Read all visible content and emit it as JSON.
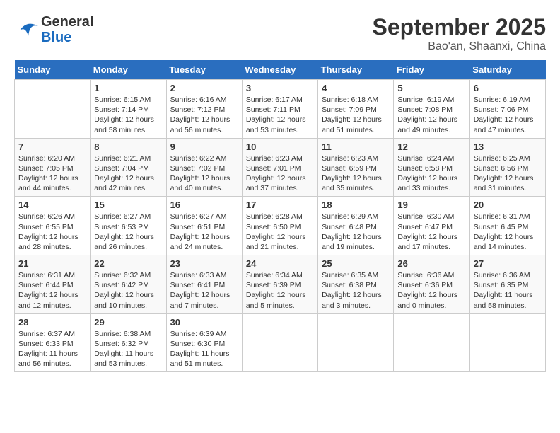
{
  "header": {
    "logo_general": "General",
    "logo_blue": "Blue",
    "month_title": "September 2025",
    "location": "Bao'an, Shaanxi, China"
  },
  "days_of_week": [
    "Sunday",
    "Monday",
    "Tuesday",
    "Wednesday",
    "Thursday",
    "Friday",
    "Saturday"
  ],
  "weeks": [
    [
      {
        "day": "",
        "info": ""
      },
      {
        "day": "1",
        "info": "Sunrise: 6:15 AM\nSunset: 7:14 PM\nDaylight: 12 hours\nand 58 minutes."
      },
      {
        "day": "2",
        "info": "Sunrise: 6:16 AM\nSunset: 7:12 PM\nDaylight: 12 hours\nand 56 minutes."
      },
      {
        "day": "3",
        "info": "Sunrise: 6:17 AM\nSunset: 7:11 PM\nDaylight: 12 hours\nand 53 minutes."
      },
      {
        "day": "4",
        "info": "Sunrise: 6:18 AM\nSunset: 7:09 PM\nDaylight: 12 hours\nand 51 minutes."
      },
      {
        "day": "5",
        "info": "Sunrise: 6:19 AM\nSunset: 7:08 PM\nDaylight: 12 hours\nand 49 minutes."
      },
      {
        "day": "6",
        "info": "Sunrise: 6:19 AM\nSunset: 7:06 PM\nDaylight: 12 hours\nand 47 minutes."
      }
    ],
    [
      {
        "day": "7",
        "info": "Sunrise: 6:20 AM\nSunset: 7:05 PM\nDaylight: 12 hours\nand 44 minutes."
      },
      {
        "day": "8",
        "info": "Sunrise: 6:21 AM\nSunset: 7:04 PM\nDaylight: 12 hours\nand 42 minutes."
      },
      {
        "day": "9",
        "info": "Sunrise: 6:22 AM\nSunset: 7:02 PM\nDaylight: 12 hours\nand 40 minutes."
      },
      {
        "day": "10",
        "info": "Sunrise: 6:23 AM\nSunset: 7:01 PM\nDaylight: 12 hours\nand 37 minutes."
      },
      {
        "day": "11",
        "info": "Sunrise: 6:23 AM\nSunset: 6:59 PM\nDaylight: 12 hours\nand 35 minutes."
      },
      {
        "day": "12",
        "info": "Sunrise: 6:24 AM\nSunset: 6:58 PM\nDaylight: 12 hours\nand 33 minutes."
      },
      {
        "day": "13",
        "info": "Sunrise: 6:25 AM\nSunset: 6:56 PM\nDaylight: 12 hours\nand 31 minutes."
      }
    ],
    [
      {
        "day": "14",
        "info": "Sunrise: 6:26 AM\nSunset: 6:55 PM\nDaylight: 12 hours\nand 28 minutes."
      },
      {
        "day": "15",
        "info": "Sunrise: 6:27 AM\nSunset: 6:53 PM\nDaylight: 12 hours\nand 26 minutes."
      },
      {
        "day": "16",
        "info": "Sunrise: 6:27 AM\nSunset: 6:51 PM\nDaylight: 12 hours\nand 24 minutes."
      },
      {
        "day": "17",
        "info": "Sunrise: 6:28 AM\nSunset: 6:50 PM\nDaylight: 12 hours\nand 21 minutes."
      },
      {
        "day": "18",
        "info": "Sunrise: 6:29 AM\nSunset: 6:48 PM\nDaylight: 12 hours\nand 19 minutes."
      },
      {
        "day": "19",
        "info": "Sunrise: 6:30 AM\nSunset: 6:47 PM\nDaylight: 12 hours\nand 17 minutes."
      },
      {
        "day": "20",
        "info": "Sunrise: 6:31 AM\nSunset: 6:45 PM\nDaylight: 12 hours\nand 14 minutes."
      }
    ],
    [
      {
        "day": "21",
        "info": "Sunrise: 6:31 AM\nSunset: 6:44 PM\nDaylight: 12 hours\nand 12 minutes."
      },
      {
        "day": "22",
        "info": "Sunrise: 6:32 AM\nSunset: 6:42 PM\nDaylight: 12 hours\nand 10 minutes."
      },
      {
        "day": "23",
        "info": "Sunrise: 6:33 AM\nSunset: 6:41 PM\nDaylight: 12 hours\nand 7 minutes."
      },
      {
        "day": "24",
        "info": "Sunrise: 6:34 AM\nSunset: 6:39 PM\nDaylight: 12 hours\nand 5 minutes."
      },
      {
        "day": "25",
        "info": "Sunrise: 6:35 AM\nSunset: 6:38 PM\nDaylight: 12 hours\nand 3 minutes."
      },
      {
        "day": "26",
        "info": "Sunrise: 6:36 AM\nSunset: 6:36 PM\nDaylight: 12 hours\nand 0 minutes."
      },
      {
        "day": "27",
        "info": "Sunrise: 6:36 AM\nSunset: 6:35 PM\nDaylight: 11 hours\nand 58 minutes."
      }
    ],
    [
      {
        "day": "28",
        "info": "Sunrise: 6:37 AM\nSunset: 6:33 PM\nDaylight: 11 hours\nand 56 minutes."
      },
      {
        "day": "29",
        "info": "Sunrise: 6:38 AM\nSunset: 6:32 PM\nDaylight: 11 hours\nand 53 minutes."
      },
      {
        "day": "30",
        "info": "Sunrise: 6:39 AM\nSunset: 6:30 PM\nDaylight: 11 hours\nand 51 minutes."
      },
      {
        "day": "",
        "info": ""
      },
      {
        "day": "",
        "info": ""
      },
      {
        "day": "",
        "info": ""
      },
      {
        "day": "",
        "info": ""
      }
    ]
  ]
}
